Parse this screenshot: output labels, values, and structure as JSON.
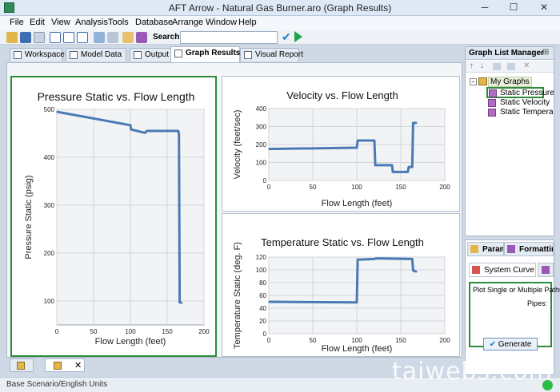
{
  "window": {
    "title": "AFT Arrow - Natural Gas Burner.aro (Graph Results)",
    "minimize": "─",
    "maximize": "☐",
    "close": "✕"
  },
  "menu": [
    "File",
    "Edit",
    "View",
    "Analysis",
    "Tools",
    "Database",
    "Arrange",
    "Window",
    "Help"
  ],
  "toolbar": {
    "search_label": "Search:",
    "search_value": ""
  },
  "tabs": [
    "Workspace",
    "Model Data",
    "Output",
    "Graph Results",
    "Visual Report"
  ],
  "active_tab": "Graph Results",
  "graph_list_manager": {
    "title": "Graph List Manager",
    "pin": "⊞",
    "tree_root": "My Graphs",
    "items": [
      "Static Pressure",
      "Static Velocity",
      "Static Temperature"
    ],
    "selected": "Static Pressure"
  },
  "props_panel": {
    "tab1": "Param",
    "tab2": "Formatting >",
    "sub_tab": "System Curve",
    "plot_label": "Plot Single or Multiple Paths:",
    "pipes_label": "Pipes:",
    "generate_label": "Generate"
  },
  "status": {
    "text": "Base Scenario/English Units"
  },
  "watermark": "taiwebs.com",
  "colors": {
    "series": "#4a7ab5",
    "selection": "#2c8a3c"
  },
  "chart_data": [
    {
      "type": "line",
      "title": "Pressure Static vs. Flow Length",
      "xlabel": "Flow Length (feet)",
      "ylabel": "Pressure Static (psig)",
      "xlim": [
        0,
        200
      ],
      "ylim": [
        50,
        500
      ],
      "xticks": [
        0,
        50,
        100,
        150,
        200
      ],
      "yticks": [
        100,
        200,
        300,
        400,
        500
      ],
      "grid": true,
      "points": [
        [
          0,
          495
        ],
        [
          100,
          467
        ],
        [
          101,
          458
        ],
        [
          120,
          451
        ],
        [
          122,
          455
        ],
        [
          165,
          455
        ],
        [
          166,
          449
        ],
        [
          167,
          97
        ],
        [
          170,
          96
        ]
      ]
    },
    {
      "type": "line",
      "title": "Velocity vs. Flow Length",
      "xlabel": "Flow Length (feet)",
      "ylabel": "Velocity (feet/sec)",
      "xlim": [
        0,
        200
      ],
      "ylim": [
        0,
        400
      ],
      "xticks": [
        0,
        50,
        100,
        150,
        200
      ],
      "yticks": [
        0,
        100,
        200,
        300,
        400
      ],
      "grid": true,
      "points": [
        [
          0,
          175
        ],
        [
          100,
          182
        ],
        [
          101,
          222
        ],
        [
          120,
          222
        ],
        [
          121,
          85
        ],
        [
          140,
          85
        ],
        [
          141,
          47
        ],
        [
          158,
          47
        ],
        [
          159,
          75
        ],
        [
          163,
          75
        ],
        [
          164,
          320
        ],
        [
          168,
          320
        ]
      ]
    },
    {
      "type": "line",
      "title": "Temperature Static vs. Flow Length",
      "xlabel": "Flow Length (feet)",
      "ylabel": "Temperature Static (deg. F)",
      "xlim": [
        0,
        200
      ],
      "ylim": [
        0,
        120
      ],
      "xticks": [
        0,
        50,
        100,
        150,
        200
      ],
      "yticks": [
        0,
        20,
        40,
        60,
        80,
        100,
        120
      ],
      "grid": true,
      "points": [
        [
          0,
          50
        ],
        [
          100,
          49
        ],
        [
          101,
          116
        ],
        [
          120,
          117
        ],
        [
          122,
          118
        ],
        [
          163,
          117
        ],
        [
          164,
          99
        ],
        [
          168,
          97
        ]
      ]
    }
  ]
}
